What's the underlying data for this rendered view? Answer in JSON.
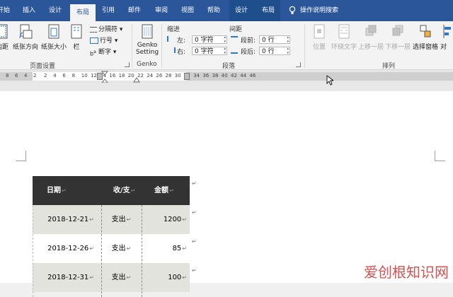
{
  "ribbon_tabs": {
    "file": "开始",
    "insert": "插入",
    "design": "设计",
    "layout": "布局",
    "references": "引用",
    "mailings": "邮件",
    "review": "审阅",
    "view": "视图",
    "help": "帮助",
    "table_design": "设计",
    "table_layout": "布局",
    "tell_me": "操作说明搜索"
  },
  "page_setup": {
    "margins": "边距",
    "orientation": "纸张方向",
    "size": "纸张大小",
    "columns": "栏",
    "breaks": "分隔符",
    "line_numbers": "行号",
    "hyphenation": "断字",
    "group_label": "页面设置"
  },
  "genko": {
    "button_line1": "Genko",
    "button_line2": "Setting",
    "group_label": "Genko"
  },
  "paragraph": {
    "indent_header": "缩进",
    "spacing_header": "间距",
    "indent_left_label": "左:",
    "indent_left_value": "0 字符",
    "indent_right_label": "右:",
    "indent_right_value": "0 字符",
    "space_before_label": "段前:",
    "space_before_value": "0 行",
    "space_after_label": "段后:",
    "space_after_value": "0 行",
    "group_label": "段落"
  },
  "arrange": {
    "position": "位置",
    "wrap_text": "环绕文字",
    "bring_forward": "上移一层",
    "send_backward": "下移一层",
    "selection_pane": "选择窗格",
    "align": "对",
    "group_label": "排列"
  },
  "ruler": {
    "numbers": [
      "8",
      "6",
      "4",
      "2",
      "2",
      "4",
      "6",
      "8",
      "10",
      "12",
      "14",
      "16",
      "18",
      "20",
      "22",
      "24",
      "26",
      "28",
      "30",
      "32",
      "34",
      "36",
      "38",
      "40",
      "42",
      "44",
      "46"
    ]
  },
  "table": {
    "headers": [
      "日期",
      "收/支",
      "金额"
    ],
    "rows": [
      [
        "2018-12-21",
        "支出",
        "1200"
      ],
      [
        "2018-12-26",
        "支出",
        "85"
      ],
      [
        "2018-12-31",
        "支出",
        "100"
      ]
    ]
  },
  "watermark": "爱创根知识网",
  "colors": {
    "ribbon_blue": "#2b579a",
    "table_header": "#333334",
    "row_shade": "#e3e3de",
    "row_plain": "#ffffff"
  }
}
